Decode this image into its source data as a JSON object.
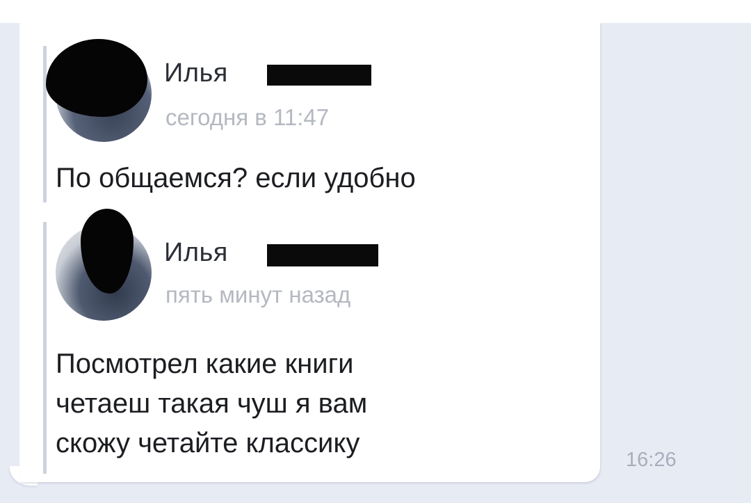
{
  "thread": {
    "timestamp": "16:26",
    "forwarded": [
      {
        "author": "Илья",
        "time": "сегодня в 11:47",
        "text": "По общаемся? если удобно"
      },
      {
        "author": "Илья",
        "time": "пять минут назад",
        "text": "Посмотрел какие книги\nчетаеш такая чуш я вам\nскожу четайте классику"
      }
    ]
  },
  "colors": {
    "background": "#e7ebf4",
    "bubble": "#ffffff",
    "muted_text": "#b4b8c0",
    "forward_bar": "#cdd3de"
  }
}
